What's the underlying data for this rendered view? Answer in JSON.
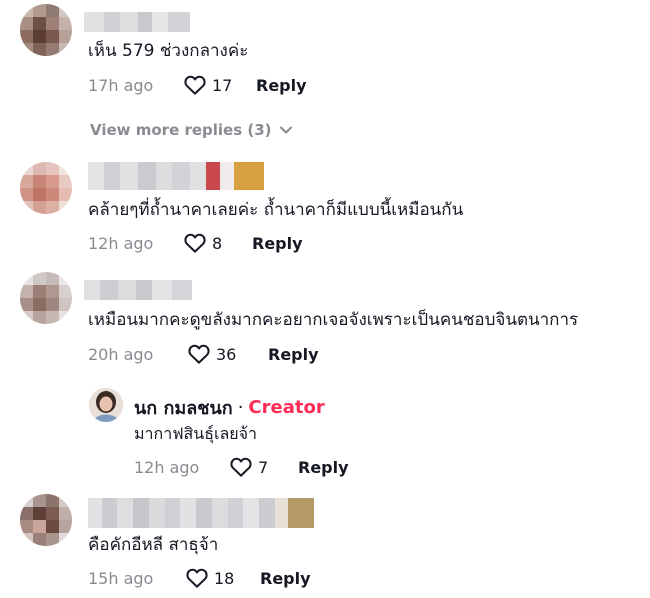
{
  "comments": [
    {
      "text": "เห็น 579 ช่วงกลางค่ะ",
      "time": "17h ago",
      "likes": "17",
      "reply": "Reply",
      "view_more": "View more replies (3)"
    },
    {
      "text": "คล้ายๆที่ถ้ำนาคาเลยค่ะ ถ้ำนาคาก็มีแบบนี้เหมือนกัน",
      "time": "12h ago",
      "likes": "8",
      "reply": "Reply"
    },
    {
      "text": "เหมือนมากคะดูขลังมากคะอยากเจอจังเพราะเป็นคนชอบจินตนาการ",
      "time": "20h ago",
      "likes": "36",
      "reply": "Reply",
      "creator_reply": {
        "name": "นก กมลชนก",
        "separator": "·",
        "tag": "Creator",
        "text": "มากาฟสินธุ์เลยจ้า",
        "time": "12h ago",
        "likes": "7",
        "reply": "Reply"
      }
    },
    {
      "text": "คือคักอีหลี สาธุจ้า",
      "time": "15h ago",
      "likes": "18",
      "reply": "Reply"
    }
  ],
  "colors": {
    "accent": "#fe2c55",
    "muted": "#8a8b91",
    "text": "#161823"
  },
  "icons": [
    "heart-icon",
    "chevron-down-icon"
  ]
}
